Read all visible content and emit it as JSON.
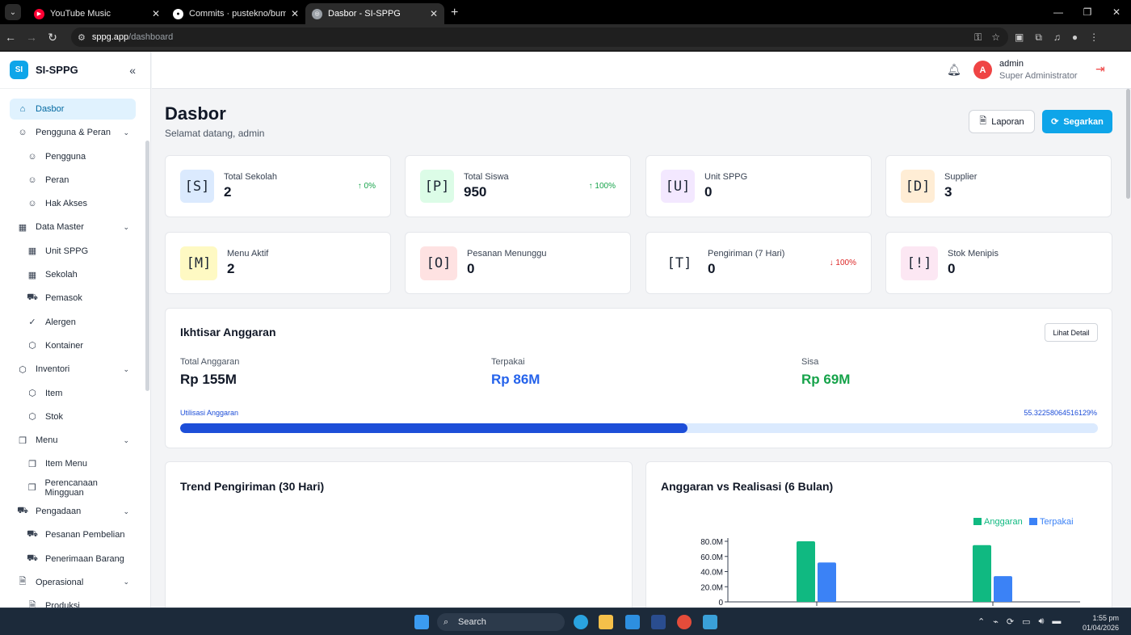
{
  "browser": {
    "tabs": [
      {
        "title": "YouTube Music",
        "color": "#ff0033"
      },
      {
        "title": "Commits · pustekno/bumdes-k",
        "color": "#ffffff"
      },
      {
        "title": "Dasbor - SI-SPPG",
        "color": "#9aa0a6"
      }
    ],
    "url_domain": "sppg.app",
    "url_path": "/dashboard"
  },
  "sidebar": {
    "logo_text": "SI",
    "brand": "SI-SPPG",
    "items": [
      {
        "label": "Dasbor",
        "icon": "home-icon",
        "sub": false,
        "active": true
      },
      {
        "label": "Pengguna & Peran",
        "icon": "users-icon",
        "sub": false,
        "group": true
      },
      {
        "label": "Pengguna",
        "icon": "users-icon",
        "sub": true
      },
      {
        "label": "Peran",
        "icon": "users-icon",
        "sub": true
      },
      {
        "label": "Hak Akses",
        "icon": "users-icon",
        "sub": true
      },
      {
        "label": "Data Master",
        "icon": "building-icon",
        "sub": false,
        "group": true
      },
      {
        "label": "Unit SPPG",
        "icon": "building-icon",
        "sub": true
      },
      {
        "label": "Sekolah",
        "icon": "building-icon",
        "sub": true
      },
      {
        "label": "Pemasok",
        "icon": "cart-icon",
        "sub": true
      },
      {
        "label": "Alergen",
        "icon": "check-circle-icon",
        "sub": true
      },
      {
        "label": "Kontainer",
        "icon": "box-icon",
        "sub": true
      },
      {
        "label": "Inventori",
        "icon": "box-icon",
        "sub": false,
        "group": true
      },
      {
        "label": "Item",
        "icon": "box-icon",
        "sub": true
      },
      {
        "label": "Stok",
        "icon": "box-icon",
        "sub": true
      },
      {
        "label": "Menu",
        "icon": "book-icon",
        "sub": false,
        "group": true
      },
      {
        "label": "Item Menu",
        "icon": "book-icon",
        "sub": true
      },
      {
        "label": "Perencanaan Mingguan",
        "icon": "book-icon",
        "sub": true
      },
      {
        "label": "Pengadaan",
        "icon": "cart-icon",
        "sub": false,
        "group": true
      },
      {
        "label": "Pesanan Pembelian",
        "icon": "cart-icon",
        "sub": true
      },
      {
        "label": "Penerimaan Barang",
        "icon": "cart-icon",
        "sub": true
      },
      {
        "label": "Operasional",
        "icon": "file-icon",
        "sub": false,
        "group": true
      },
      {
        "label": "Produksi",
        "icon": "file-icon",
        "sub": true
      }
    ]
  },
  "header": {
    "avatar_letter": "A",
    "user_name": "admin",
    "user_role": "Super Administrator"
  },
  "page": {
    "title": "Dasbor",
    "subtitle": "Selamat datang, admin",
    "report_button": "Laporan",
    "refresh_button": "Segarkan"
  },
  "stats": [
    {
      "key": "S",
      "label": "Total Sekolah",
      "value": "2",
      "trend": "↑ 0%",
      "dir": "up",
      "bg": "#dbeafe"
    },
    {
      "key": "P",
      "label": "Total Siswa",
      "value": "950",
      "trend": "↑ 100%",
      "dir": "up",
      "bg": "#dcfce7"
    },
    {
      "key": "U",
      "label": "Unit SPPG",
      "value": "0",
      "trend": "",
      "dir": "",
      "bg": "#f3e8ff"
    },
    {
      "key": "D",
      "label": "Supplier",
      "value": "3",
      "trend": "",
      "dir": "",
      "bg": "#ffedd5"
    },
    {
      "key": "M",
      "label": "Menu Aktif",
      "value": "2",
      "trend": "",
      "dir": "",
      "bg": "#fef9c3"
    },
    {
      "key": "O",
      "label": "Pesanan Menunggu",
      "value": "0",
      "trend": "",
      "dir": "",
      "bg": "#fee2e2"
    },
    {
      "key": "T",
      "label": "Pengiriman (7 Hari)",
      "value": "0",
      "trend": "↓ 100%",
      "dir": "down",
      "bg": "#ffffff"
    },
    {
      "key": "!",
      "label": "Stok Menipis",
      "value": "0",
      "trend": "",
      "dir": "",
      "bg": "#fce7f3"
    }
  ],
  "budget": {
    "title": "Ikhtisar Anggaran",
    "detail_button": "Lihat Detail",
    "total_label": "Total Anggaran",
    "total_value": "Rp 155M",
    "used_label": "Terpakai",
    "used_value": "Rp 86M",
    "remain_label": "Sisa",
    "remain_value": "Rp 69M",
    "util_label": "Utilisasi Anggaran",
    "util_text": "55.32258064516129%",
    "util_fraction": 0.5532
  },
  "trend_card": {
    "title": "Trend Pengiriman (30 Hari)"
  },
  "chart_card": {
    "title": "Anggaran vs Realisasi (6 Bulan)"
  },
  "chart_data": {
    "type": "bar",
    "title": "Anggaran vs Realisasi (6 Bulan)",
    "categories": [
      "",
      ""
    ],
    "series": [
      {
        "name": "Anggaran",
        "values": [
          80,
          75
        ],
        "color": "#10b981"
      },
      {
        "name": "Terpakai",
        "values": [
          52,
          34
        ],
        "color": "#3b82f6"
      }
    ],
    "yticks": [
      "80.0M",
      "60.0M",
      "40.0M",
      "20.0M",
      "0"
    ],
    "ylim": [
      0,
      80
    ],
    "legend": "top-right"
  },
  "taskbar": {
    "search": "Search",
    "time": "1:55 pm",
    "date": "01/04/2026"
  }
}
